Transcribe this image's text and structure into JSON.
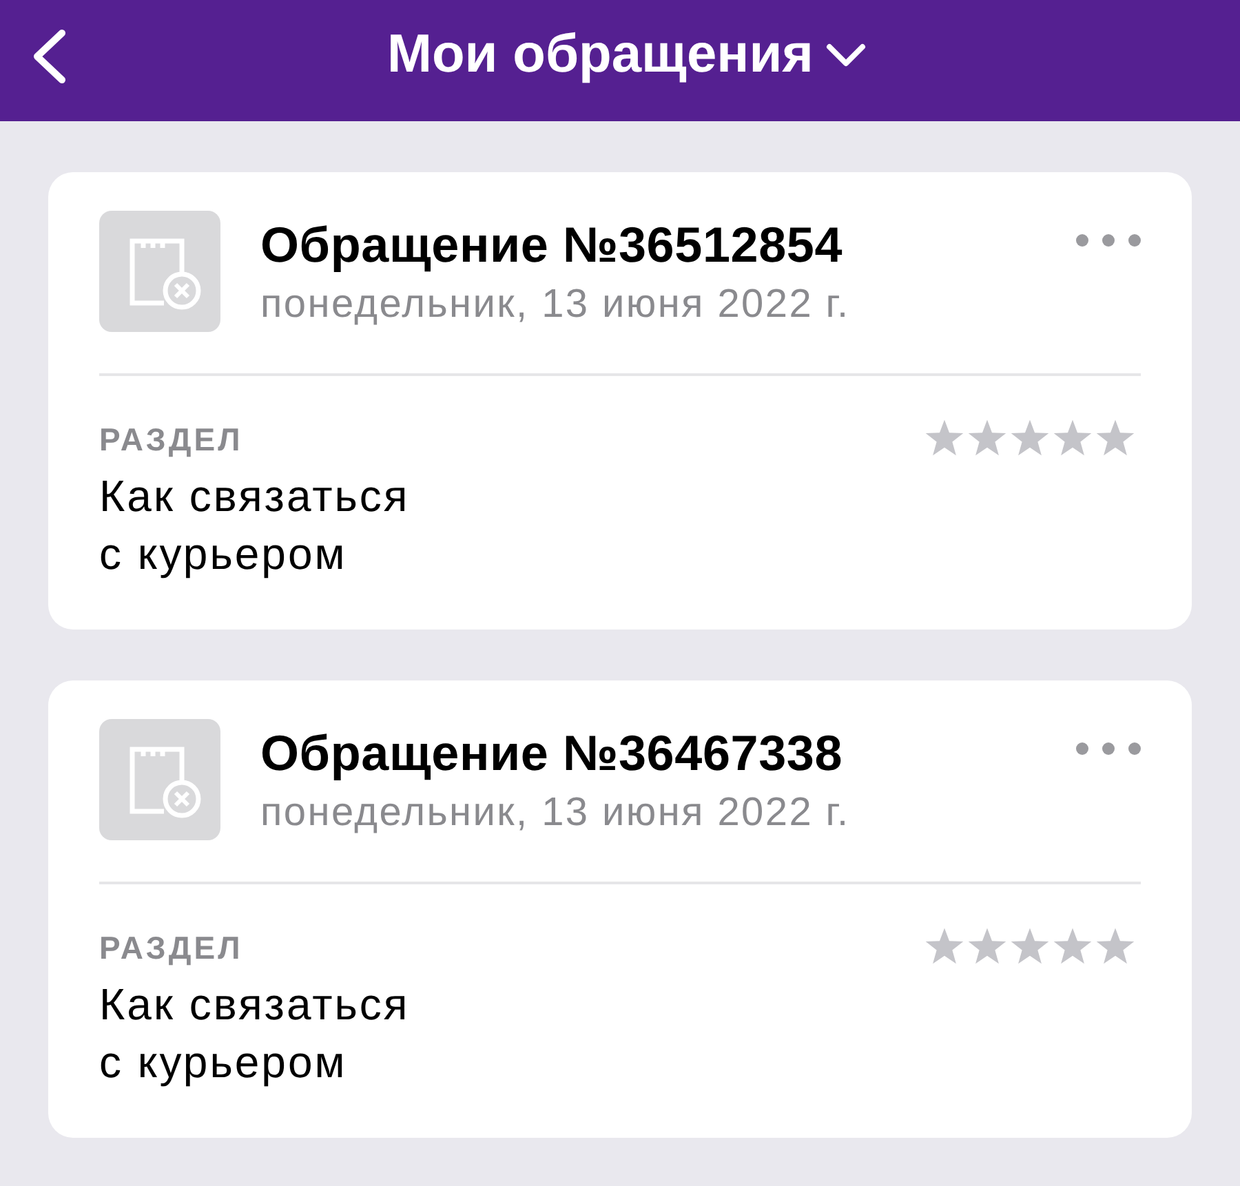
{
  "header": {
    "title": "Мои обращения"
  },
  "tickets": [
    {
      "title": "Обращение №36512854",
      "date": "понедельник, 13 июня 2022 г.",
      "section_label": "РАЗДЕЛ",
      "section": "Как связаться\nс курьером",
      "stars": 0
    },
    {
      "title": "Обращение №36467338",
      "date": "понедельник, 13 июня 2022 г.",
      "section_label": "РАЗДЕЛ",
      "section": "Как связаться\nс курьером",
      "stars": 0
    }
  ]
}
